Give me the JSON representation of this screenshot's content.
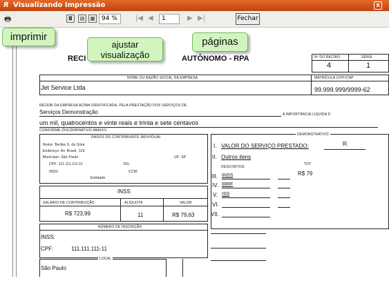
{
  "window": {
    "title": "Visualizando Impressão",
    "close": "x"
  },
  "toolbar": {
    "zoom": "94 %",
    "page": "1",
    "close_label": "Fechar"
  },
  "callouts": {
    "print": "imprimir",
    "fit_view": "ajustar\nvisualização",
    "pages": "páginas"
  },
  "doc": {
    "title_left": "RECI",
    "title_right": "AUTÔNOMO - RPA",
    "no_recibo_label": "Nº DO RECIBO",
    "no_recibo": "4",
    "serie_label": "SÉRIE",
    "serie": "1",
    "matricula_label": "MATRÍCULA (CPF/CNP",
    "cnpj": "99.999.999/9999-62",
    "nome_label": "NOME OU RAZÃO SOCIAL DA EMPRESA",
    "empresa": "Jet Service Ltda",
    "recebi_label": "RECEBI DA EMPRESA ACIMA IDENTIFICADA, PELA PRESTAÇÃO DOS SERVIÇOS DE",
    "servico": "Serviços Demonstração",
    "importancia_label": "A IMPORTÂNCIA LÍQUIDA D",
    "valor_extenso": "um mil, quatrocentos e vinte reais e trinta e sete centavos",
    "conforme_label": "CONFORME DISCRIMINATIVO ABAIXO:",
    "contrib_label": "DADOS DO CONTRIBUINTE INDIVIDUAL",
    "nome_row": "Nome:  Beriba S. da Silva",
    "endereco_row": "Endereço:  Av. Brasil, 123",
    "municipio_row": "Município:  São Paulo",
    "uf_row": "UF:  SP",
    "cpf_row": "CPF:  111.111.111-11",
    "rg_row": "RG:",
    "inss_row": "INSS:",
    "ccm_row": "CCM:",
    "entidade_row": "Entidade",
    "demonst_label": "DEMONSTRATIVO",
    "d1_num": "I.",
    "d1": "VALOR DO SERVIÇO PRESTADO:",
    "d1_val": "R:",
    "d2_num": "II.",
    "d2": "Outros itens",
    "tot_label": "TOT",
    "desc_label": "DESCONTOS:",
    "d3_num": "III.",
    "d3": "INSS",
    "d3_val": "R$ 79",
    "d4_num": "IV.",
    "d4": "IRRF",
    "d5_num": "V.",
    "d5": "ISS",
    "d6_num": "VI.",
    "d7_num": "VII.",
    "inss_box_title": "INSS",
    "sal_label": "SALÁRIO-DE-CONTRIBUIÇÃO",
    "aliq_label": "ALÍQUOTA",
    "valor_label": "VALOR",
    "sal": "R$ 723,99",
    "aliq": "11",
    "valor": "R$ 79,63",
    "insc_label": "NÚMERO DE INSCRIÇÃO",
    "insc_inss": "INSS:",
    "insc_cpf": "CPF:",
    "insc_cpf_val": "111.111.111-11",
    "local_label": "LOCAL",
    "local": "São Paulo"
  }
}
